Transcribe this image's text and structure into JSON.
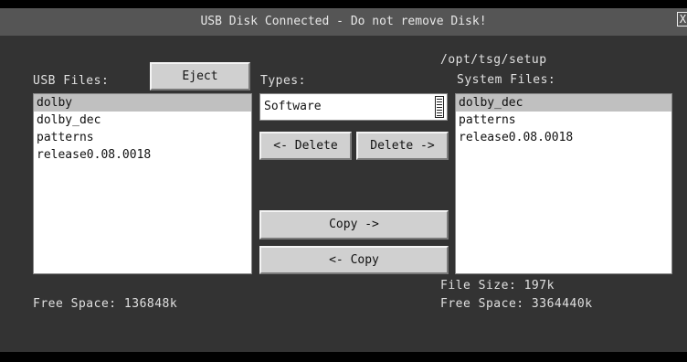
{
  "title": "USB Disk Connected - Do not remove Disk!",
  "close_label": "X",
  "usb": {
    "label": "USB Files:",
    "eject_label": "Eject",
    "items": [
      "dolby",
      "dolby_dec",
      "patterns",
      "release0.08.0018"
    ],
    "selected_index": 0,
    "free_space": "Free Space: 136848k"
  },
  "types": {
    "label": "Types:",
    "selected": "Software"
  },
  "buttons": {
    "delete_left": "<- Delete",
    "delete_right": "Delete ->",
    "copy_right": "Copy ->",
    "copy_left": "<- Copy"
  },
  "system": {
    "path": "/opt/tsg/setup",
    "label": "System Files:",
    "items": [
      "dolby_dec",
      "patterns",
      "release0.08.0018"
    ],
    "selected_index": 0,
    "file_size": "File Size: 197k",
    "free_space": "Free Space: 3364440k"
  },
  "colors": {
    "background": "#333333",
    "titlebar": "#555555",
    "selection": "#c0c0c0"
  }
}
